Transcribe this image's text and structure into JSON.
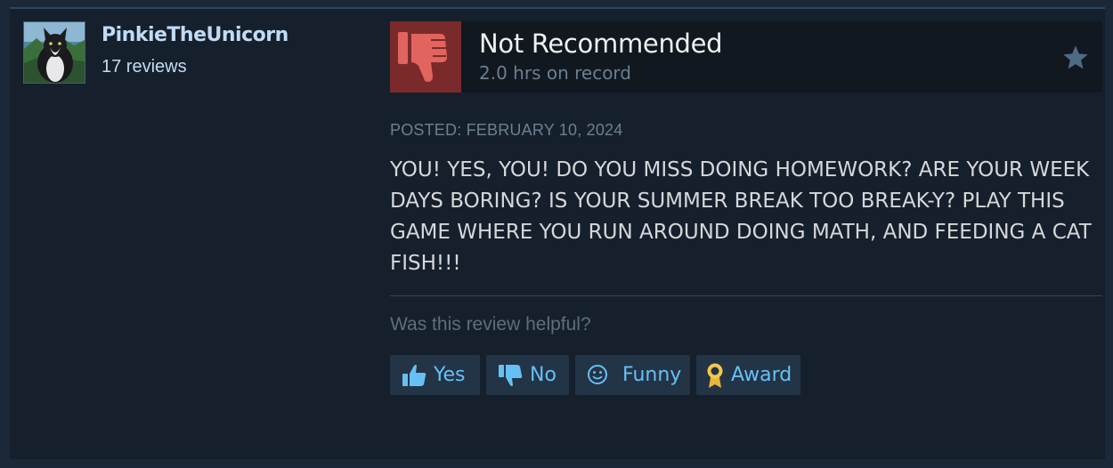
{
  "author": {
    "username": "PinkieTheUnicorn",
    "review_count": "17 reviews"
  },
  "review": {
    "verdict": "Not Recommended",
    "hours": "2.0 hrs on record",
    "posted": "POSTED: FEBRUARY 10, 2024",
    "body": "YOU! YES, YOU! DO YOU MISS DOING HOMEWORK? ARE YOUR WEEK DAYS BORING? IS YOUR SUMMER BREAK TOO BREAK-Y? PLAY THIS GAME WHERE YOU RUN AROUND DOING MATH, AND FEEDING A CAT FISH!!!"
  },
  "feedback": {
    "prompt": "Was this review helpful?",
    "yes_label": "Yes",
    "no_label": "No",
    "funny_label": "Funny",
    "award_label": "Award"
  },
  "colors": {
    "background": "#1b2838",
    "card": "#16202d",
    "accent_blue": "#66c0f4",
    "not_recommended_red": "#7a2a2a"
  },
  "icons": [
    "avatar-image",
    "thumbs-down-icon",
    "star-icon",
    "thumbs-up-icon",
    "smiley-icon",
    "award-ribbon-icon"
  ]
}
